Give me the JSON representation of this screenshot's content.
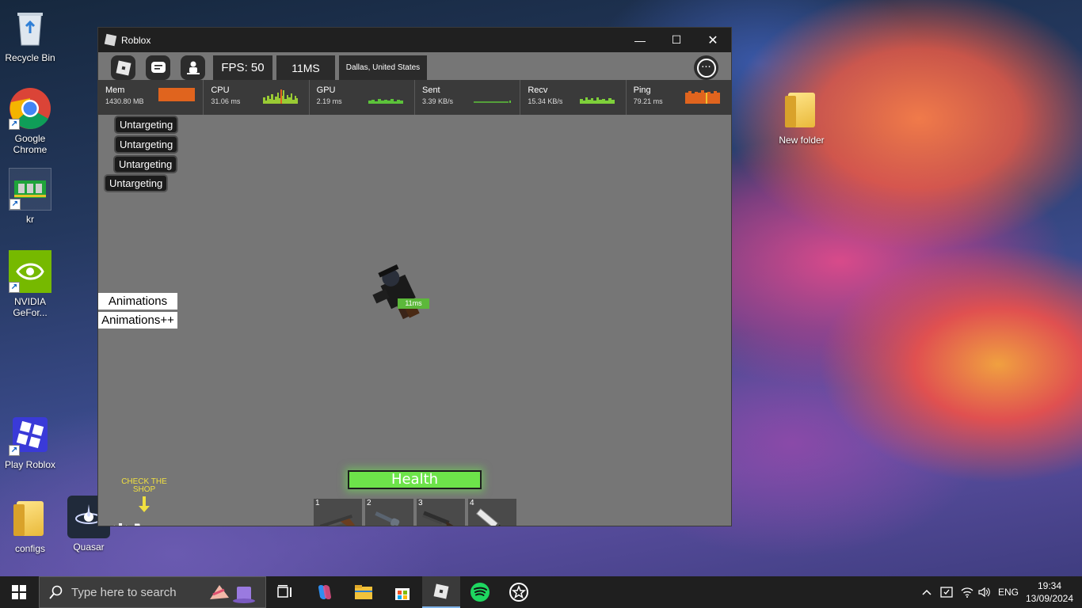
{
  "desktop": {
    "icons": [
      {
        "label": "Recycle Bin"
      },
      {
        "label": "Google Chrome"
      },
      {
        "label": "kr"
      },
      {
        "label": "NVIDIA GeFor..."
      },
      {
        "label": "Play Roblox"
      },
      {
        "label": "configs"
      },
      {
        "label": "Quasar"
      },
      {
        "label": "New folder"
      }
    ]
  },
  "window": {
    "title": "Roblox",
    "controls": {
      "minimize": "—",
      "maximize": "☐",
      "close": "✕"
    }
  },
  "topbar": {
    "fps": "FPS: 50",
    "ping_ms": "11MS",
    "location": "Dallas, United States",
    "more_icon": "···"
  },
  "stats": [
    {
      "name": "Mem",
      "value": "1430.80 MB",
      "graph_color": "#e0641e"
    },
    {
      "name": "CPU",
      "value": "31.06 ms",
      "graph_color": "#9acb34"
    },
    {
      "name": "GPU",
      "value": "2.19 ms",
      "graph_color": "#5cc23a"
    },
    {
      "name": "Sent",
      "value": "3.39 KB/s",
      "graph_color": "#5cc23a"
    },
    {
      "name": "Recv",
      "value": "15.34 KB/s",
      "graph_color": "#7ed03a"
    },
    {
      "name": "Ping",
      "value": "79.21 ms",
      "graph_color": "#e0641e"
    }
  ],
  "game": {
    "untargeting": [
      "Untargeting",
      "Untargeting",
      "Untargeting",
      "Untargeting"
    ],
    "animations": "Animations",
    "animations_plus": "Animations++",
    "player_tag": "11ms",
    "health": "Health",
    "shop_hint": "CHECK THE SHOP",
    "hotbar": [
      {
        "slot": "1",
        "item": "shotgun-icon"
      },
      {
        "slot": "2",
        "item": "revolver-icon"
      },
      {
        "slot": "3",
        "item": "sawed-off-icon"
      },
      {
        "slot": "4",
        "item": "knife-icon"
      }
    ]
  },
  "taskbar": {
    "search_placeholder": "Type here to search",
    "language": "ENG",
    "time": "19:34",
    "date": "13/09/2024"
  }
}
